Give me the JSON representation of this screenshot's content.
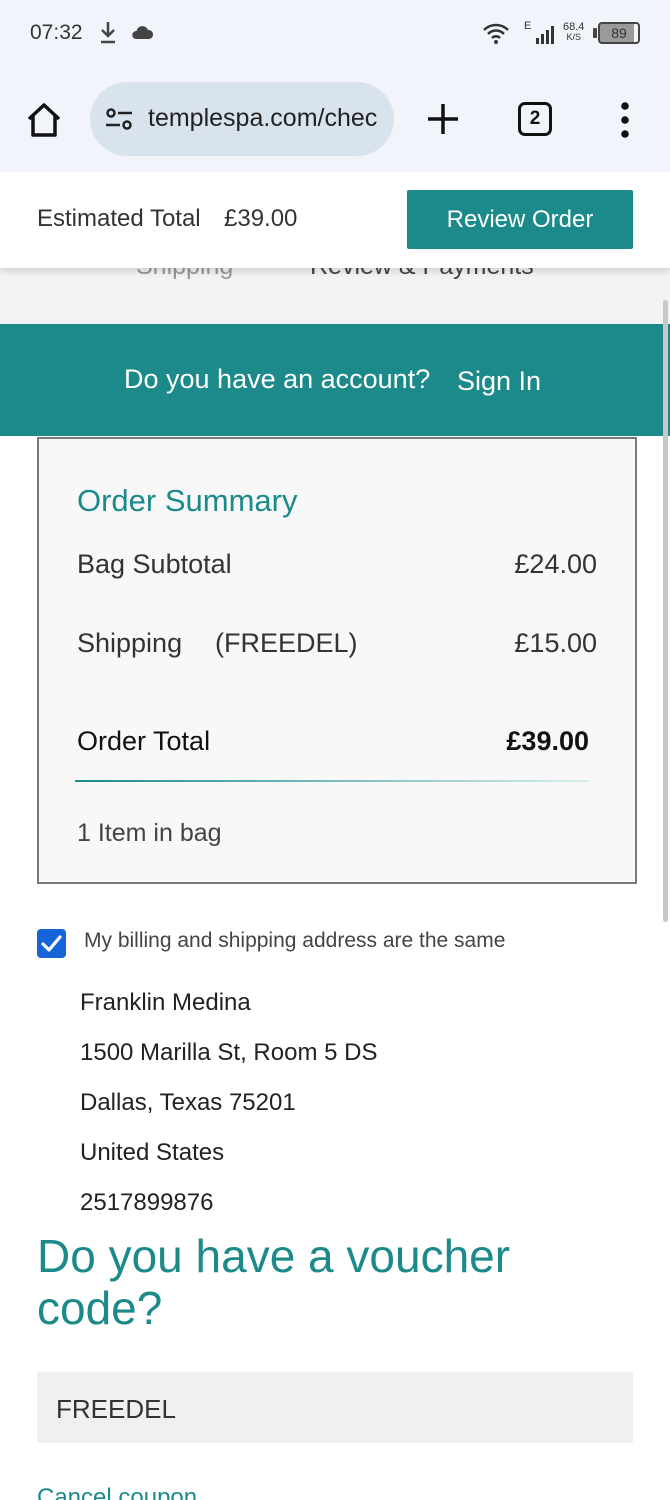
{
  "status_bar": {
    "time": "07:32",
    "network_type": "E",
    "net_speed_value": "68.4",
    "net_speed_unit": "K/S",
    "battery": "89"
  },
  "browser": {
    "url": "templespa.com/chec",
    "tab_count": "2"
  },
  "sticky": {
    "estimated_total_label": "Estimated Total",
    "estimated_total_value": "£39.00",
    "review_button": "Review Order"
  },
  "steps": {
    "step1": "Shipping",
    "step2": "Review & Payments"
  },
  "account_banner": {
    "question": "Do you have an account?",
    "sign_in": "Sign In"
  },
  "summary": {
    "title": "Order Summary",
    "subtotal_label": "Bag Subtotal",
    "subtotal_value": "£24.00",
    "shipping_label": "Shipping",
    "shipping_code": "(FREEDEL)",
    "shipping_value": "£15.00",
    "total_label": "Order Total",
    "total_value": "£39.00",
    "items_count": "1 Item in bag"
  },
  "billing": {
    "same_address_label": "My billing and shipping address are the same",
    "checked": true,
    "address_lines": [
      "Franklin Medina",
      "1500 Marilla St, Room 5 DS",
      "Dallas, Texas 75201",
      "United States",
      "2517899876"
    ]
  },
  "voucher": {
    "heading": "Do you have a voucher code?",
    "code_value": "FREEDEL",
    "cancel_link": "Cancel coupon"
  },
  "colors": {
    "accent": "#1c8a8a",
    "checkbox": "#1565d8"
  }
}
